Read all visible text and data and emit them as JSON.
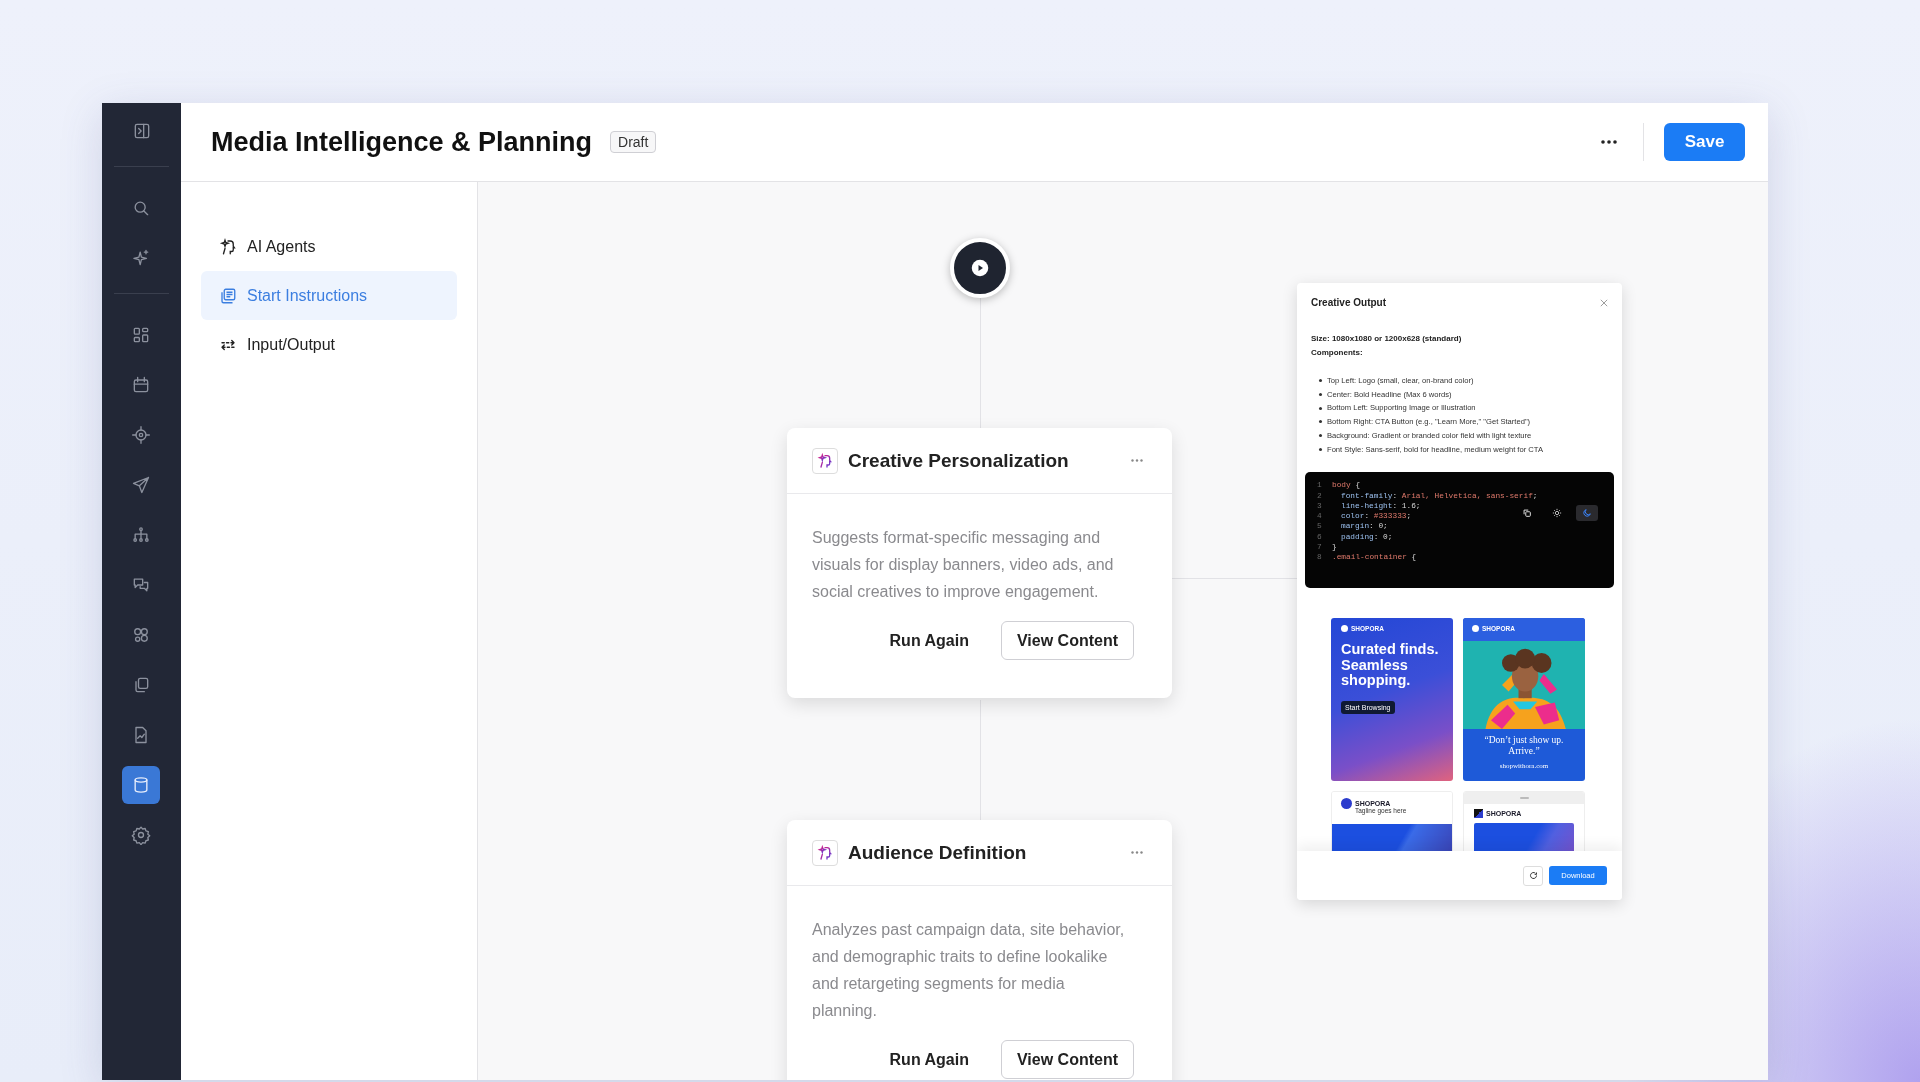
{
  "rail": {
    "groups": [
      {
        "items": [
          {
            "selected": false
          }
        ]
      },
      {
        "items": [
          {
            "selected": false
          },
          {
            "selected": false
          }
        ]
      },
      {
        "items": [
          {
            "selected": false
          },
          {
            "selected": false
          },
          {
            "selected": false
          },
          {
            "selected": false
          },
          {
            "selected": false
          },
          {
            "selected": false
          },
          {
            "selected": false
          },
          {
            "selected": false
          },
          {
            "selected": false
          },
          {
            "selected": true
          },
          {
            "selected": false
          }
        ]
      }
    ]
  },
  "header": {
    "title": "Media Intelligence & Planning",
    "badge": "Draft",
    "save": "Save"
  },
  "nav": [
    {
      "label": "AI Agents",
      "selected": false
    },
    {
      "label": "Start Instructions",
      "selected": true
    },
    {
      "label": "Input/Output",
      "selected": false
    }
  ],
  "cards": [
    {
      "title": "Creative Personalization",
      "description": "Suggests format-specific messaging and visuals for display banners, video ads, and social creatives to improve engagement.",
      "buttons": [
        {
          "label": "Run Again",
          "kind": "text"
        },
        {
          "label": "View Content",
          "kind": "outline"
        }
      ]
    },
    {
      "title": "Audience Definition",
      "description": "Analyzes past campaign data, site behavior, and demographic traits to define lookalike and retargeting segments for media planning.",
      "buttons": [
        {
          "label": "Run Again",
          "kind": "text"
        },
        {
          "label": "View Content",
          "kind": "outline"
        }
      ]
    }
  ],
  "output_panel": {
    "title": "Creative Output",
    "size": "Size: 1080x1080 or 1200x628 (standard)",
    "components_label": "Components:",
    "components": [
      "Top Left: Logo (small, clear, on-brand color)",
      "Center: Bold Headline (Max 6 words)",
      "Bottom Left: Supporting Image or Illustration",
      "Bottom Right: CTA Button (e.g., \"Learn More,\" \"Get Started\")",
      "Background: Gradient or branded color field with light texture",
      "Font Style: Sans-serif, bold for headline, medium weight for CTA"
    ],
    "code": {
      "lines": [
        {
          "number": "1",
          "indent": false,
          "tokens": [
            {
              "text": "body",
              "kind": "selector"
            },
            {
              "text": " {",
              "kind": "punct"
            }
          ]
        },
        {
          "number": "2",
          "indent": true,
          "tokens": [
            {
              "text": "font-family",
              "kind": "property"
            },
            {
              "text": ": ",
              "kind": "punct"
            },
            {
              "text": "Arial, Helvetica, sans-serif",
              "kind": "string"
            },
            {
              "text": ";",
              "kind": "punct"
            }
          ]
        },
        {
          "number": "3",
          "indent": true,
          "tokens": [
            {
              "text": "line-height",
              "kind": "property"
            },
            {
              "text": ": 1.6;",
              "kind": "punct"
            }
          ]
        },
        {
          "number": "4",
          "indent": true,
          "tokens": [
            {
              "text": "color",
              "kind": "property"
            },
            {
              "text": ": ",
              "kind": "punct"
            },
            {
              "text": "#333333",
              "kind": "string"
            },
            {
              "text": ";",
              "kind": "punct"
            }
          ]
        },
        {
          "number": "5",
          "indent": true,
          "tokens": [
            {
              "text": "margin",
              "kind": "property"
            },
            {
              "text": ": 0;",
              "kind": "punct"
            }
          ]
        },
        {
          "number": "6",
          "indent": true,
          "tokens": [
            {
              "text": "padding",
              "kind": "property"
            },
            {
              "text": ": 0;",
              "kind": "punct"
            }
          ]
        },
        {
          "number": "7",
          "indent": false,
          "tokens": [
            {
              "text": "}",
              "kind": "punct"
            }
          ]
        },
        {
          "number": "8",
          "indent": false,
          "tokens": [
            {
              "text": ".email-container",
              "kind": "selector"
            },
            {
              "text": " {",
              "kind": "punct"
            }
          ]
        }
      ],
      "tools": [
        {
          "kind": "copy"
        },
        {
          "kind": "light",
          "selected": false
        },
        {
          "kind": "dark",
          "selected": true
        }
      ]
    },
    "ads": [
      {
        "kind": "headline",
        "brand": "SHOPORA",
        "headline": "Curated finds. Seamless shopping.",
        "cta": "Start Browsing"
      },
      {
        "brand": "SHOPORA",
        "quote": "“Don’t just show up. Arrive.”",
        "url": "shopwithora.com"
      },
      {
        "kind": "banner",
        "brand": "SHOPORA",
        "tagline": "Tagline goes here"
      },
      {
        "kind": "mobile",
        "brand": "SHOPORA"
      }
    ],
    "download": "Download"
  }
}
